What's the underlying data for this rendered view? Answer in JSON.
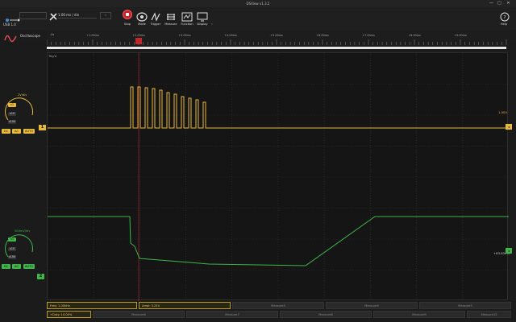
{
  "titlebar": {
    "title": "DSView v1.3.2",
    "minimize": "—",
    "maximize": "□",
    "close": "✕"
  },
  "toolbar": {
    "device_select": "...",
    "timebase": "1.00 ms / div",
    "buttons": {
      "stop": "Stop",
      "mode": "Mode",
      "trigger": "Trigger",
      "measure": "Measure",
      "function": "Function",
      "display": "Display"
    },
    "help": "Help",
    "usb": "USB 1.0",
    "mode_name": "Oscilloscope"
  },
  "timeline": {
    "ticks": [
      "+1.00ms",
      "+2.00ms",
      "+3.00ms",
      "+4.00ms",
      "+5.00ms",
      "+6.00ms",
      "+7.00ms",
      "+8.00ms",
      "+9.00ms"
    ],
    "start": "-0s"
  },
  "plot": {
    "ch1_label": "Trig'd",
    "ch1_scale": "1.00V",
    "ch2_scale": "+83.83mV",
    "ch1_color": "#e8b93a",
    "ch2_color": "#3fb54a"
  },
  "channels": {
    "ch1": {
      "vdiv": "2V/div",
      "btn_a": "x1",
      "btn_b": "x10",
      "btn_c": "x100",
      "coupling": [
        "DC",
        "AC",
        "AUTO"
      ],
      "id": "1"
    },
    "ch2": {
      "vdiv": "500mV/div",
      "btn_a": "x1",
      "btn_b": "x10",
      "btn_c": "x100",
      "coupling": [
        "DC",
        "AC",
        "AUTO"
      ],
      "id": "2"
    }
  },
  "measure": {
    "row1": [
      "Freq: 1.00kHz",
      "Ampl: 3.25V",
      "Measure3",
      "Measure4",
      "Measure5"
    ],
    "row2": [
      "+Duty: 14.00%",
      "Measure6",
      "Measure7",
      "Measure8",
      "Measure9",
      "Measure10"
    ]
  }
}
